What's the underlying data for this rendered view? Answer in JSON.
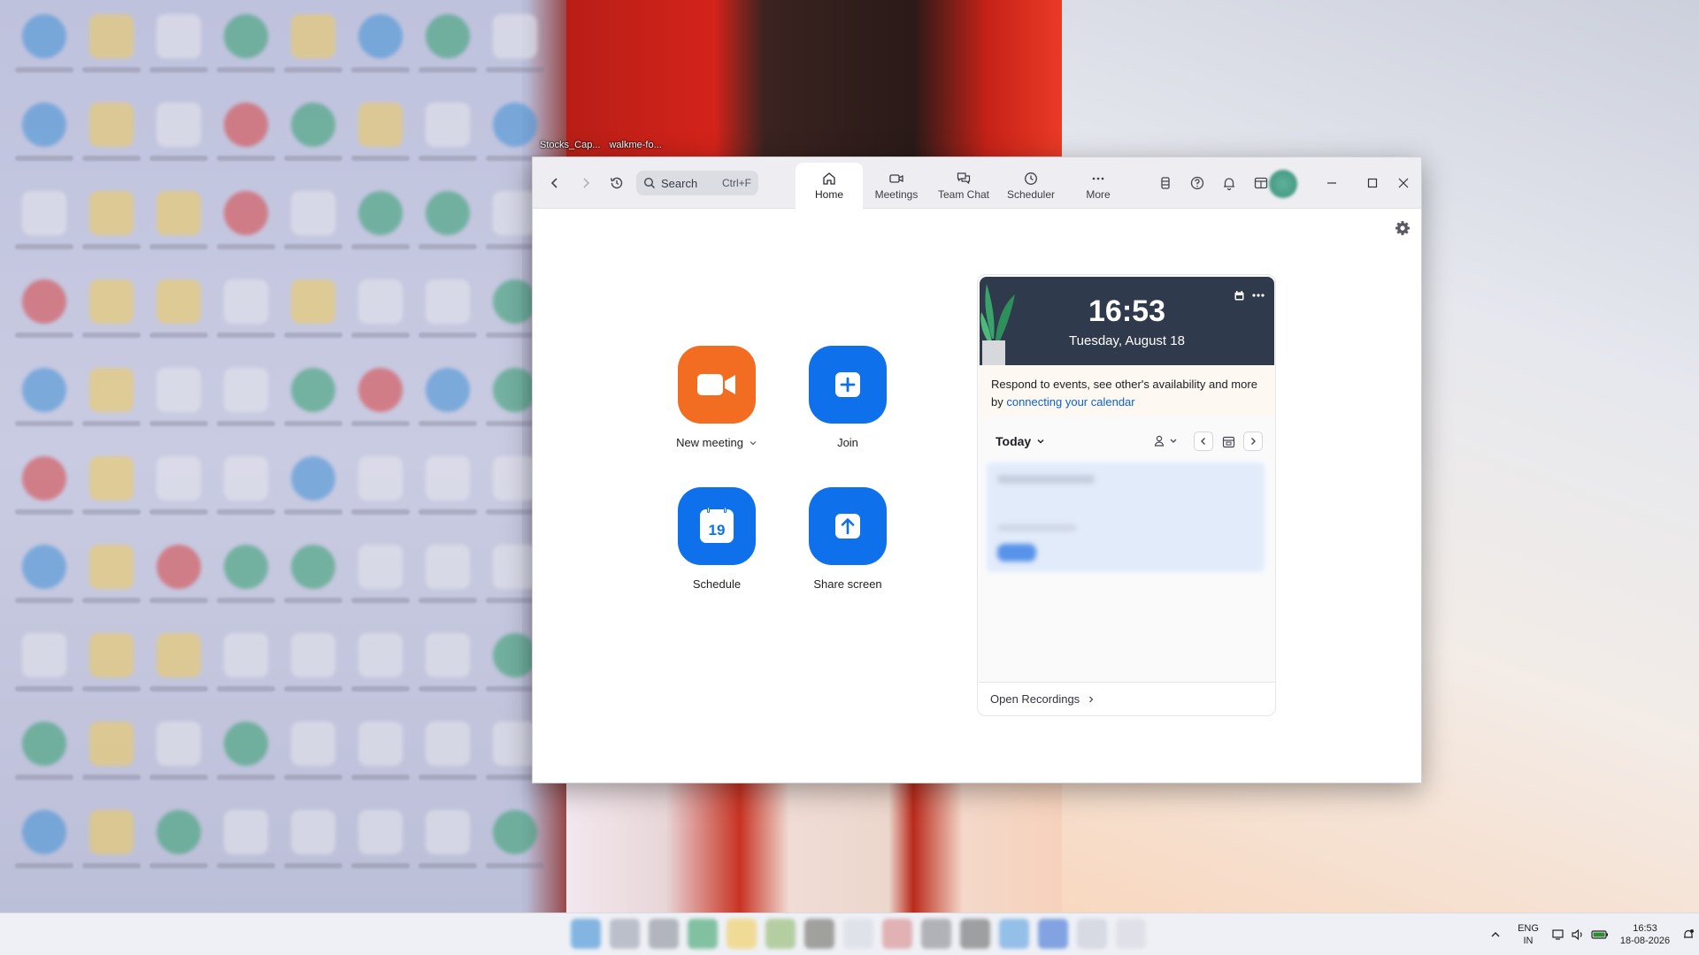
{
  "desktop": {
    "shortcut_labels": [
      "Stocks_Cap...",
      "walkme-fo..."
    ]
  },
  "window": {
    "search": {
      "placeholder": "Search",
      "shortcut": "Ctrl+F"
    },
    "tabs": [
      {
        "label": "Home",
        "icon": "home-icon",
        "active": true
      },
      {
        "label": "Meetings",
        "icon": "video-icon",
        "active": false
      },
      {
        "label": "Team Chat",
        "icon": "chat-icon",
        "active": false
      },
      {
        "label": "Scheduler",
        "icon": "clock-icon",
        "active": false
      },
      {
        "label": "More",
        "icon": "more-icon",
        "active": false
      }
    ]
  },
  "actions": {
    "new_meeting": "New meeting",
    "join": "Join",
    "schedule": "Schedule",
    "schedule_day": "19",
    "share_screen": "Share screen"
  },
  "calendar": {
    "time": "16:53",
    "date": "Tuesday, August 18",
    "notice_text": "Respond to events, see other's availability and more by ",
    "notice_link": "connecting your calendar",
    "today_label": "Today",
    "footer": "Open Recordings"
  },
  "taskbar": {
    "lang_top": "ENG",
    "lang_bottom": "IN",
    "clock_time": "16:53",
    "clock_date": "18-08-2026"
  },
  "colors": {
    "orange": "#f26d21",
    "blue": "#0e71eb",
    "hero": "#2f3b4c",
    "link": "#0e62c7"
  }
}
